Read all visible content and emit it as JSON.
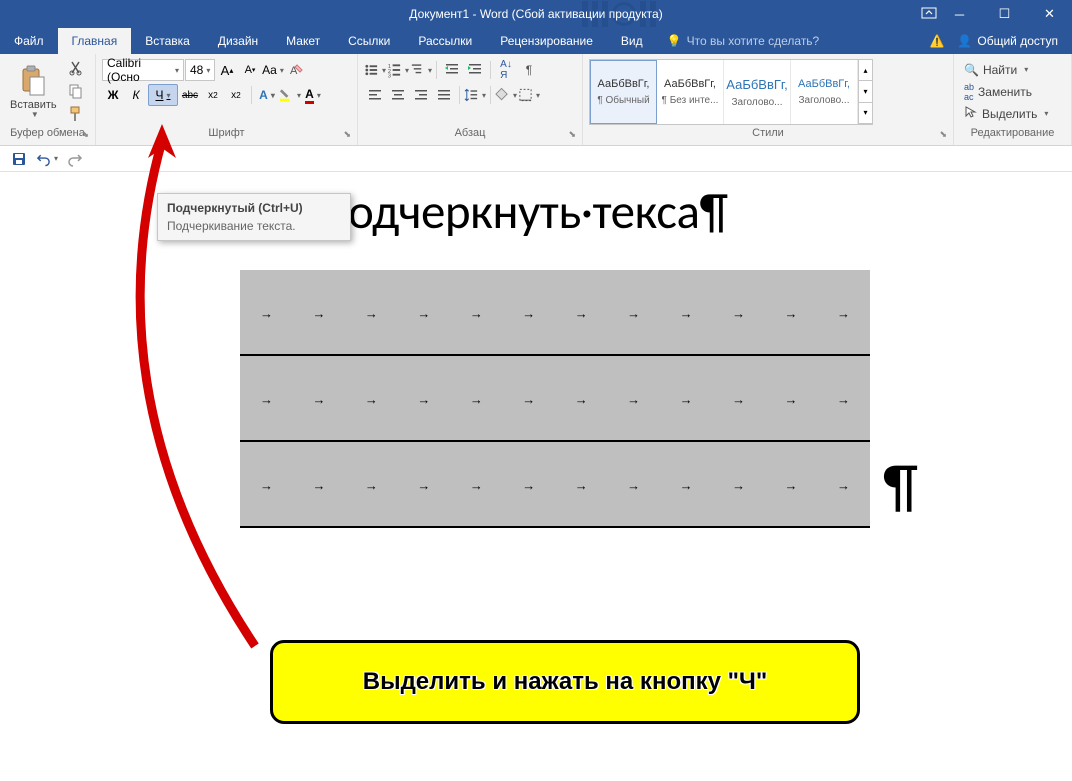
{
  "titlebar": {
    "title": "Документ1 - Word (Сбой активации продукта)"
  },
  "tabs": {
    "file": "Файл",
    "home": "Главная",
    "insert": "Вставка",
    "design": "Дизайн",
    "layout": "Макет",
    "references": "Ссылки",
    "mailings": "Рассылки",
    "review": "Рецензирование",
    "view": "Вид",
    "tell_me": "Что вы хотите сделать?",
    "share": "Общий доступ"
  },
  "ribbon": {
    "clipboard": {
      "label": "Буфер обмена",
      "paste": "Вставить"
    },
    "font": {
      "label": "Шрифт",
      "font_name": "Calibri (Осно",
      "font_size": "48",
      "bold": "Ж",
      "italic": "К",
      "underline": "Ч",
      "strikethrough": "abc",
      "subscript": "x₂",
      "superscript": "x²",
      "case": "Aa"
    },
    "paragraph": {
      "label": "Абзац"
    },
    "styles": {
      "label": "Стили",
      "preview_text": "АаБбВвГг,",
      "items": [
        {
          "name": "¶ Обычный",
          "selected": true,
          "heading": false
        },
        {
          "name": "¶ Без инте...",
          "selected": false,
          "heading": false
        },
        {
          "name": "Заголово...",
          "selected": false,
          "heading": true
        },
        {
          "name": "Заголово...",
          "selected": false,
          "heading": true
        }
      ]
    },
    "editing": {
      "label": "Редактирование",
      "find": "Найти",
      "replace": "Заменить",
      "select": "Выделить"
    }
  },
  "tooltip": {
    "title": "Подчеркнутый (Ctrl+U)",
    "desc": "Подчеркивание текста."
  },
  "document": {
    "heading": "Как·подчеркнуть·текса¶"
  },
  "callout": {
    "text": "Выделить и нажать на кнопку \"Ч\""
  }
}
